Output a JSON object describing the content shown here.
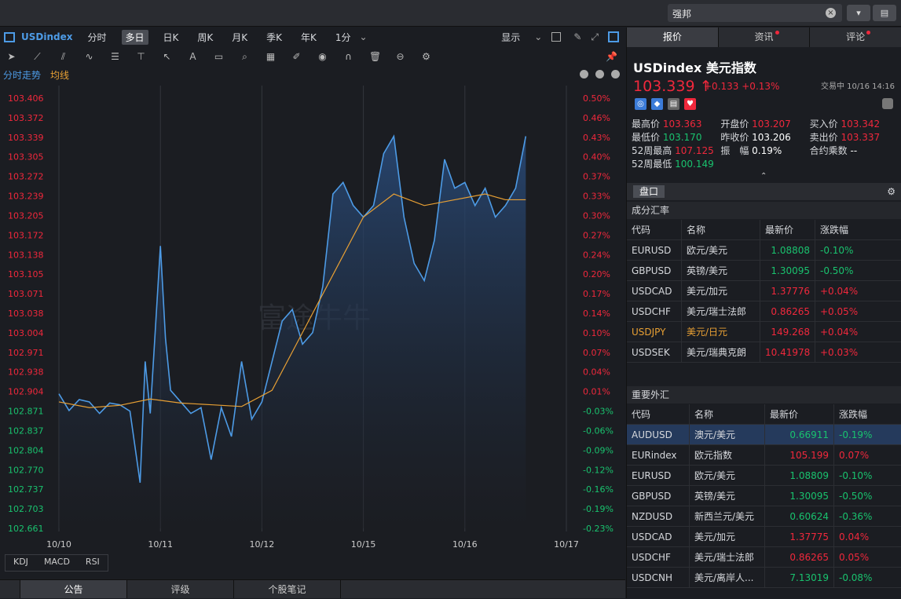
{
  "search": {
    "value": "强邦"
  },
  "topbar": {
    "skin_icon": "shirt-icon",
    "layout_icon": "layout-icon"
  },
  "toolbar": {
    "symbol": "USDindex",
    "periods": [
      "分时",
      "多日",
      "日K",
      "周K",
      "月K",
      "季K",
      "年K",
      "1分"
    ],
    "active_period": "多日",
    "display_label": "显示"
  },
  "chart_tabs": {
    "tab1": "分时走势",
    "tab2": "均线"
  },
  "watermark": "富途牛牛",
  "chart_data": {
    "type": "line",
    "title": "",
    "x_labels": [
      "10/10",
      "10/11",
      "10/12",
      "10/15",
      "10/16",
      "10/17"
    ],
    "y_ticks": [
      103.406,
      103.372,
      103.339,
      103.305,
      103.272,
      103.239,
      103.205,
      103.172,
      103.138,
      103.105,
      103.071,
      103.038,
      103.004,
      102.971,
      102.938,
      102.904,
      102.871,
      102.837,
      102.804,
      102.77,
      102.737,
      102.703,
      102.661
    ],
    "pct_ticks": [
      "0.50%",
      "0.46%",
      "0.43%",
      "0.40%",
      "0.37%",
      "0.33%",
      "0.30%",
      "0.27%",
      "0.24%",
      "0.20%",
      "0.17%",
      "0.14%",
      "0.10%",
      "0.07%",
      "0.04%",
      "0.01%",
      "-0.03%",
      "-0.06%",
      "-0.09%",
      "-0.12%",
      "-0.16%",
      "-0.19%",
      "-0.23%"
    ],
    "ylim": [
      102.661,
      103.406
    ],
    "series": [
      {
        "color": "#4d9be6",
        "x": [
          0,
          0.1,
          0.2,
          0.3,
          0.4,
          0.5,
          0.6,
          0.7,
          0.8,
          0.85,
          0.9,
          1.0,
          1.05,
          1.1,
          1.2,
          1.3,
          1.4,
          1.5,
          1.6,
          1.7,
          1.8,
          1.9,
          2.0,
          2.1,
          2.2,
          2.3,
          2.4,
          2.5,
          2.6,
          2.7,
          2.8,
          2.9,
          3.0,
          3.1,
          3.2,
          3.3,
          3.4,
          3.5,
          3.6,
          3.7,
          3.8,
          3.9,
          4.0,
          4.1,
          4.2,
          4.3,
          4.4,
          4.5,
          4.6
        ],
        "y": [
          102.894,
          102.865,
          102.884,
          102.88,
          102.86,
          102.878,
          102.875,
          102.864,
          102.74,
          102.95,
          102.86,
          103.15,
          102.99,
          102.9,
          102.88,
          102.86,
          102.87,
          102.78,
          102.87,
          102.82,
          102.95,
          102.85,
          102.88,
          102.95,
          103.02,
          103.04,
          102.98,
          103.0,
          103.08,
          103.24,
          103.26,
          103.22,
          103.2,
          103.22,
          103.31,
          103.34,
          103.2,
          103.12,
          103.09,
          103.16,
          103.3,
          103.25,
          103.26,
          103.22,
          103.25,
          103.2,
          103.22,
          103.25,
          103.34
        ]
      },
      {
        "color": "#e8a034",
        "x": [
          0,
          0.3,
          0.6,
          0.9,
          1.2,
          1.5,
          1.8,
          2.1,
          2.4,
          2.7,
          3.0,
          3.3,
          3.6,
          3.9,
          4.2,
          4.4,
          4.6
        ],
        "y": [
          102.88,
          102.87,
          102.874,
          102.885,
          102.878,
          102.875,
          102.872,
          102.9,
          103.0,
          103.1,
          103.2,
          103.24,
          103.22,
          103.23,
          103.24,
          103.23,
          103.23
        ]
      }
    ]
  },
  "indicators": [
    "KDJ",
    "MACD",
    "RSI"
  ],
  "bottom_tabs": [
    "公告",
    "评级",
    "个股笔记"
  ],
  "right_tabs": [
    "报价",
    "资讯",
    "评论"
  ],
  "quote": {
    "symbol": "USDindex",
    "name": "美元指数",
    "price": "103.339",
    "change": "+0.133",
    "change_pct": "+0.13%",
    "status": "交易中 10/16 14:16",
    "rows": [
      [
        {
          "l": "最高价",
          "v": "103.363",
          "c": "up"
        },
        {
          "l": "开盘价",
          "v": "103.207",
          "c": "up"
        },
        {
          "l": "买入价",
          "v": "103.342",
          "c": "up"
        }
      ],
      [
        {
          "l": "最低价",
          "v": "103.170",
          "c": "dn"
        },
        {
          "l": "昨收价",
          "v": "103.206",
          "c": "wh"
        },
        {
          "l": "卖出价",
          "v": "103.337",
          "c": "up"
        }
      ],
      [
        {
          "l": "52周最高",
          "v": "107.125",
          "c": "up"
        },
        {
          "l": "振　幅",
          "v": "0.19%",
          "c": "wh"
        },
        {
          "l": "合约乘数",
          "v": "--",
          "c": "wh"
        }
      ],
      [
        {
          "l": "52周最低",
          "v": "100.149",
          "c": "dn"
        }
      ]
    ]
  },
  "panel": {
    "label": "盘口"
  },
  "components": {
    "title": "成分汇率",
    "headers": [
      "代码",
      "名称",
      "最新价",
      "涨跌幅"
    ],
    "rows": [
      {
        "code": "EURUSD",
        "name": "欧元/美元",
        "price": "1.08808",
        "pct": "-0.10%",
        "c": "dn"
      },
      {
        "code": "GBPUSD",
        "name": "英镑/美元",
        "price": "1.30095",
        "pct": "-0.50%",
        "c": "dn"
      },
      {
        "code": "USDCAD",
        "name": "美元/加元",
        "price": "1.37776",
        "pct": "+0.04%",
        "c": "up"
      },
      {
        "code": "USDCHF",
        "name": "美元/瑞士法郎",
        "price": "0.86265",
        "pct": "+0.05%",
        "c": "up"
      },
      {
        "code": "USDJPY",
        "name": "美元/日元",
        "price": "149.268",
        "pct": "+0.04%",
        "c": "up",
        "hl": true
      },
      {
        "code": "USDSEK",
        "name": "美元/瑞典克朗",
        "price": "10.41978",
        "pct": "+0.03%",
        "c": "up"
      }
    ]
  },
  "forex": {
    "title": "重要外汇",
    "headers": [
      "代码",
      "名称",
      "最新价",
      "涨跌幅"
    ],
    "rows": [
      {
        "code": "AUDUSD",
        "name": "澳元/美元",
        "price": "0.66911",
        "pct": "-0.19%",
        "c": "dn"
      },
      {
        "code": "EURindex",
        "name": "欧元指数",
        "price": "105.199",
        "pct": "0.07%",
        "c": "up"
      },
      {
        "code": "EURUSD",
        "name": "欧元/美元",
        "price": "1.08809",
        "pct": "-0.10%",
        "c": "dn"
      },
      {
        "code": "GBPUSD",
        "name": "英镑/美元",
        "price": "1.30095",
        "pct": "-0.50%",
        "c": "dn"
      },
      {
        "code": "NZDUSD",
        "name": "新西兰元/美元",
        "price": "0.60624",
        "pct": "-0.36%",
        "c": "dn"
      },
      {
        "code": "USDCAD",
        "name": "美元/加元",
        "price": "1.37775",
        "pct": "0.04%",
        "c": "up"
      },
      {
        "code": "USDCHF",
        "name": "美元/瑞士法郎",
        "price": "0.86265",
        "pct": "0.05%",
        "c": "up"
      },
      {
        "code": "USDCNH",
        "name": "美元/离岸人...",
        "price": "7.13019",
        "pct": "-0.08%",
        "c": "dn"
      }
    ]
  }
}
